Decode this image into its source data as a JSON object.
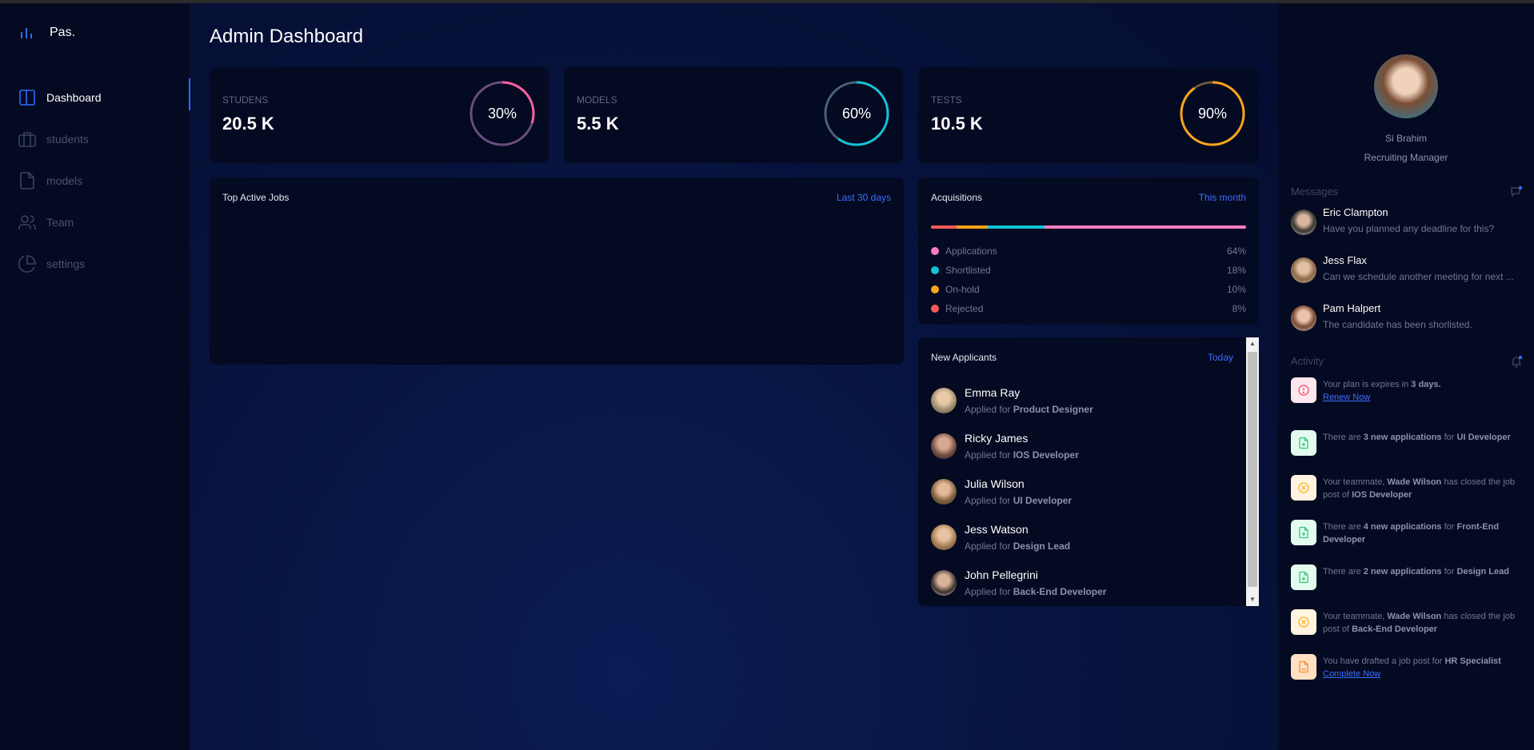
{
  "app": {
    "logo_text": "Pas."
  },
  "sidebar": {
    "items": [
      {
        "label": "Dashboard",
        "icon": "layout-icon",
        "active": true
      },
      {
        "label": "students",
        "icon": "briefcase-icon"
      },
      {
        "label": "models",
        "icon": "file-icon"
      },
      {
        "label": "Team",
        "icon": "users-icon"
      },
      {
        "label": "settings",
        "icon": "pie-chart-icon"
      }
    ]
  },
  "main": {
    "title": "Admin Dashboard",
    "stats": [
      {
        "label": "STUDENS",
        "value": "20.5 K",
        "percent": 30,
        "percent_text": "30%",
        "color": "#ff5fa2"
      },
      {
        "label": "MODELS",
        "value": "5.5 K",
        "percent": 60,
        "percent_text": "60%",
        "color": "#13c2d6"
      },
      {
        "label": "TESTS",
        "value": "10.5 K",
        "percent": 90,
        "percent_text": "90%",
        "color": "#ffa41b"
      }
    ],
    "top_jobs": {
      "title": "Top Active Jobs",
      "link": "Last 30 days"
    },
    "acquisitions": {
      "title": "Acquisitions",
      "link": "This month",
      "items": [
        {
          "label": "Applications",
          "percent": "64%",
          "value": 64,
          "color": "#ff7ac2"
        },
        {
          "label": "Shortlisted",
          "percent": "18%",
          "value": 18,
          "color": "#13c2d6"
        },
        {
          "label": "On-hold",
          "percent": "10%",
          "value": 10,
          "color": "#ffa41b"
        },
        {
          "label": "Rejected",
          "percent": "8%",
          "value": 8,
          "color": "#ff5a5a"
        }
      ]
    },
    "new_applicants": {
      "title": "New Applicants",
      "link": "Today",
      "prefix": "Applied for",
      "items": [
        {
          "name": "Emma Ray",
          "role": "Product Designer"
        },
        {
          "name": "Ricky James",
          "role": "IOS Developer"
        },
        {
          "name": "Julia Wilson",
          "role": "UI Developer"
        },
        {
          "name": "Jess Watson",
          "role": "Design Lead"
        },
        {
          "name": "John Pellegrini",
          "role": "Back-End Developer"
        }
      ]
    }
  },
  "profile": {
    "name": "Si Brahim",
    "role": "Recruiting Manager"
  },
  "messages": {
    "title": "Messages",
    "items": [
      {
        "name": "Eric Clampton",
        "text": "Have you planned any deadline for this?"
      },
      {
        "name": "Jess Flax",
        "text": "Can we schedule another meeting for next ..."
      },
      {
        "name": "Pam Halpert",
        "text": "The candidate has been shorlisted."
      }
    ]
  },
  "activity": {
    "title": "Activity",
    "items": [
      {
        "icon": "alert-icon",
        "parts": [
          "Your plan is expires in ",
          "3 days.",
          ""
        ],
        "link": "Renew Now",
        "bg": "#fde7ee",
        "fg": "#ff5a7a"
      },
      {
        "icon": "file-plus-icon",
        "parts": [
          "There are ",
          "3 new applications",
          " for ",
          "UI Developer"
        ],
        "bg": "#e3fbef",
        "fg": "#34c77b"
      },
      {
        "icon": "close-circle-icon",
        "parts": [
          "Your teammate, ",
          "Wade Wilson",
          " has closed the job post of ",
          "IOS Developer"
        ],
        "bg": "#fff4df",
        "fg": "#ffb224"
      },
      {
        "icon": "file-plus-icon",
        "parts": [
          "There are ",
          "4 new applications",
          " for ",
          "Front-End Developer"
        ],
        "bg": "#e3fbef",
        "fg": "#34c77b"
      },
      {
        "icon": "file-plus-icon",
        "parts": [
          "There are ",
          "2 new applications",
          " for ",
          "Design Lead"
        ],
        "bg": "#e3fbef",
        "fg": "#34c77b"
      },
      {
        "icon": "close-circle-icon",
        "parts": [
          "Your teammate, ",
          "Wade Wilson",
          " has closed the job post of ",
          "Back-End Developer"
        ],
        "bg": "#fff4df",
        "fg": "#ffb224"
      },
      {
        "icon": "file-edit-icon",
        "parts": [
          "You have drafted a job post for ",
          "HR Specialist",
          "",
          ""
        ],
        "link": "Complete Now",
        "bg": "#ffe0c4",
        "fg": "#ff8a2b"
      }
    ]
  }
}
